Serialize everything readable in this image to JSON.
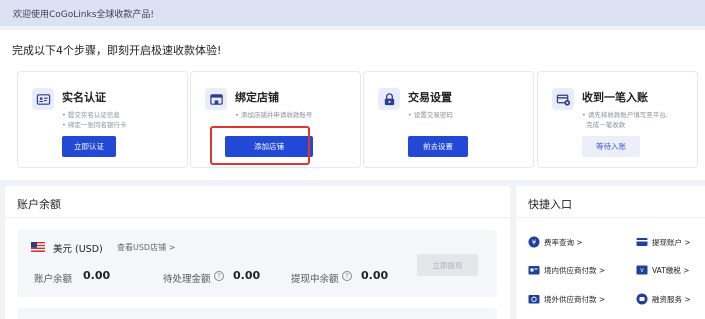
{
  "banner": {
    "text": "欢迎使用CoGoLinks全球收款产品!"
  },
  "steps": {
    "title": "完成以下4个步骤，即刻开启极速收款体验!",
    "cards": [
      {
        "icon": "id-card-icon",
        "title": "实名认证",
        "bullets": [
          "提交实名认证信息",
          "绑定一张同名银行卡"
        ],
        "button": "立即认证"
      },
      {
        "icon": "store-icon",
        "title": "绑定店铺",
        "bullets": [
          "添加店铺并申请收款账号"
        ],
        "button": "添加店铺"
      },
      {
        "icon": "lock-icon",
        "title": "交易设置",
        "bullets": [
          "设置交易密码"
        ],
        "button": "前去设置"
      },
      {
        "icon": "payment-icon",
        "title": "收到一笔入账",
        "bullets": [
          "请先将收款账户填写至平台,",
          "完成一笔收款"
        ],
        "button": "等待入账"
      }
    ]
  },
  "balance": {
    "title": "账户余额",
    "currency": "美元 (USD)",
    "shops_link": "查看USD店铺",
    "chevron": ">",
    "account_balance_label": "账户余额",
    "account_balance_value": "0.00",
    "pending_label": "待处理金额",
    "pending_value": "0.00",
    "withdrawing_label": "提现中余额",
    "withdrawing_value": "0.00",
    "withdraw_button": "立即提现"
  },
  "quick": {
    "title": "快捷入口",
    "items": [
      {
        "icon": "rate-icon",
        "label": "费率查询 >"
      },
      {
        "icon": "card-icon",
        "label": "提现账户 >"
      },
      {
        "icon": "domestic-supplier-icon",
        "label": "境内供应商付款 >"
      },
      {
        "icon": "vat-icon",
        "label": "VAT缴税 >"
      },
      {
        "icon": "overseas-supplier-icon",
        "label": "境外供应商付款 >"
      },
      {
        "icon": "financing-icon",
        "label": "融资服务 >"
      }
    ]
  },
  "colors": {
    "primary": "#2248d6",
    "highlight": "#e0342f",
    "banner": "#dde1f4"
  }
}
